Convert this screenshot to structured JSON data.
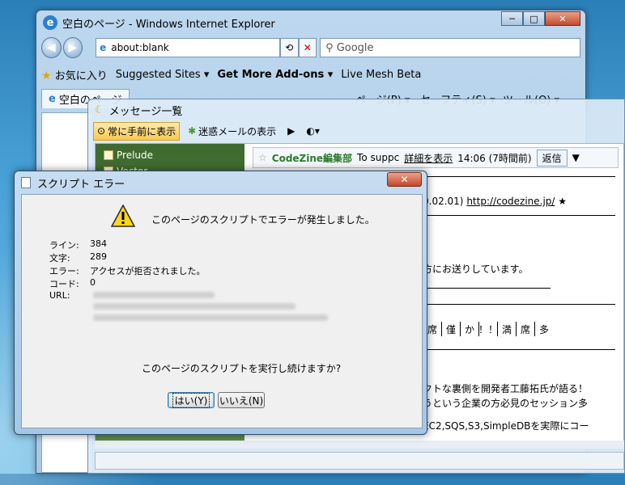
{
  "ie": {
    "title": "空白のページ - Windows Internet Explorer",
    "address": "about:blank",
    "search_placeholder": "Google",
    "favorites": "お気に入り",
    "suggested_sites": "Suggested Sites ▾",
    "get_more_addons": "Get More Add-ons ▾",
    "live_mesh": "Live Mesh Beta",
    "tab_label": "空白のページ",
    "menu_page": "ページ(P) ▾",
    "menu_safety": "セーフティ(S) ▾",
    "menu_tools": "ツール(O) ▾"
  },
  "mail": {
    "window_title": "メッセージ一覧",
    "toolbar_always_on_top": "常に手前に表示",
    "toolbar_spam": "迷惑メールの表示",
    "folders": [
      "Prelude",
      "Vector"
    ],
    "header_sender": "CodeZine編集部",
    "header_to": "To suppc",
    "header_details": "詳細を表示",
    "header_time": "14:06 (7時間前)",
    "reply": "返信",
    "line1": "0.02.01)",
    "line1_link": "http://codezine.jp/",
    "line1_star": "★",
    "line2": "方にお送りしています。",
    "grid_cells": [
      "席",
      "僅",
      "か",
      "！！",
      "満",
      "席",
      "多"
    ],
    "line3": "クトな裏側を開発者工藤拓氏が語る！",
    "line4": "うという企業の方必見のセッション多",
    "line5": "EC2,SQS,S3,SimpleDBを実際にコー"
  },
  "dialog": {
    "title": "スクリプト エラー",
    "close": "✕",
    "headline": "このページのスクリプトでエラーが発生しました。",
    "labels": {
      "line": "ライン:",
      "char": "文字:",
      "error": "エラー:",
      "code": "コード:",
      "url": "URL:"
    },
    "values": {
      "line": "384",
      "char": "289",
      "error": "アクセスが拒否されました。",
      "code": "0"
    },
    "question": "このページのスクリプトを実行し続けますか?",
    "yes": "はい(Y)",
    "no": "いいえ(N)"
  }
}
